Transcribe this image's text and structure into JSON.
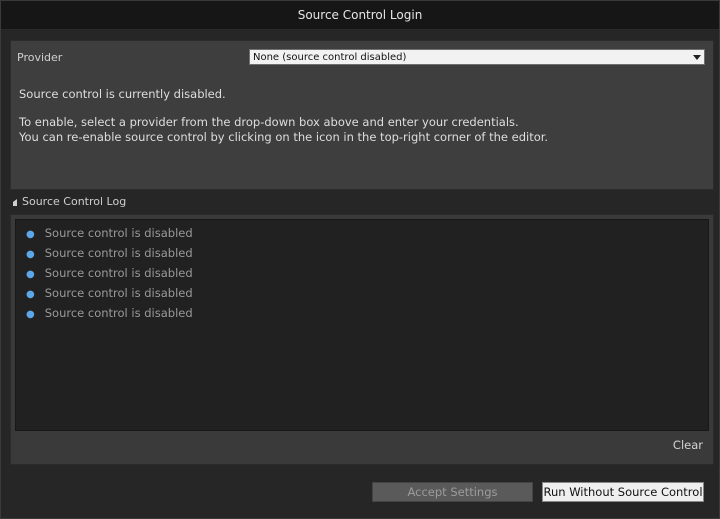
{
  "window": {
    "title": "Source Control Login"
  },
  "provider": {
    "label": "Provider",
    "selected": "None  (source control disabled)"
  },
  "messages": {
    "line1": "Source control is currently disabled.",
    "line2": "To enable, select a provider from the drop-down box above and enter your credentials.",
    "line3": "You can re-enable source control by clicking on the icon in the top-right corner of the editor."
  },
  "log": {
    "header": "Source Control Log",
    "items": [
      "Source control is disabled",
      "Source control is disabled",
      "Source control is disabled",
      "Source control is disabled",
      "Source control is disabled"
    ],
    "clear_label": "Clear"
  },
  "buttons": {
    "accept_label": "Accept Settings",
    "run_label": "Run Without Source Control"
  },
  "colors": {
    "bullet": "#5da6e8",
    "panel": "#3e3e3e",
    "log_bg": "#212121"
  }
}
